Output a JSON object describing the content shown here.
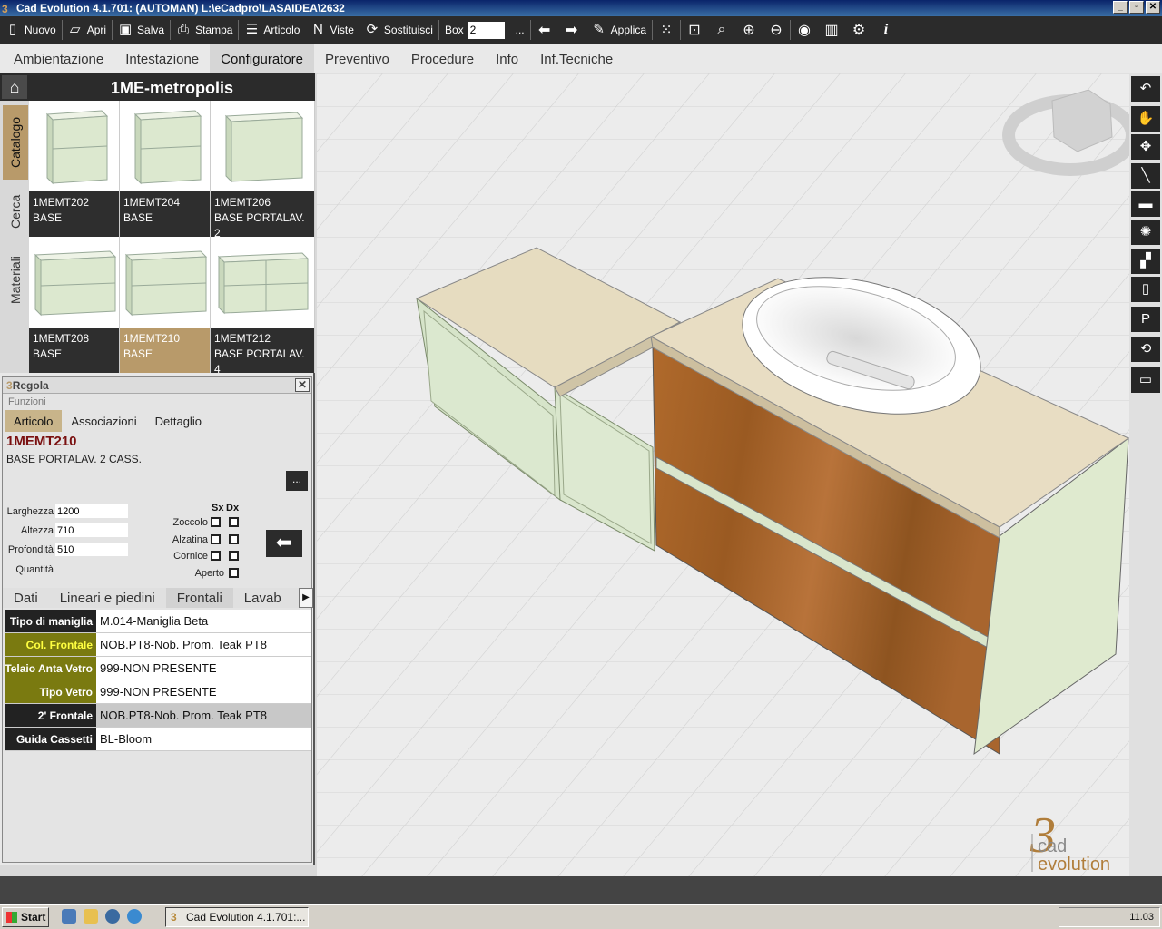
{
  "window": {
    "title": "Cad Evolution 4.1.701: (AUTOMAN)  L:\\eCadpro\\LASAIDEA\\2632",
    "min": "_",
    "max": "▫",
    "close": "✕"
  },
  "toolbar": {
    "new": "Nuovo",
    "open": "Apri",
    "save": "Salva",
    "print": "Stampa",
    "article": "Articolo",
    "views": "Viste",
    "replace": "Sostituisci",
    "box_label": "Box",
    "box_value": "2",
    "ellipsis": "...",
    "apply": "Applica"
  },
  "menu": [
    "Ambientazione",
    "Intestazione",
    "Configuratore",
    "Preventivo",
    "Procedure",
    "Info",
    "Inf.Tecniche"
  ],
  "menu_active": "Configuratore",
  "catalog": {
    "title": "1ME-metropolis",
    "side_tabs": [
      "Catalogo",
      "Cerca",
      "Materiali"
    ],
    "items": [
      {
        "code": "1MEMT202",
        "desc": "BASE"
      },
      {
        "code": "1MEMT204",
        "desc": "BASE"
      },
      {
        "code": "1MEMT206",
        "desc": "BASE PORTALAV. 2"
      },
      {
        "code": "1MEMT208",
        "desc": "BASE"
      },
      {
        "code": "1MEMT210",
        "desc": "BASE"
      },
      {
        "code": "1MEMT212",
        "desc": "BASE PORTALAV. 4"
      }
    ],
    "selected": "1MEMT210"
  },
  "regola": {
    "title": "Regola",
    "close": "✕",
    "funzioni": "Funzioni",
    "tabs": [
      "Articolo",
      "Associazioni",
      "Dettaglio"
    ],
    "active_tab": "Articolo",
    "code": "1MEMT210",
    "desc": "BASE PORTALAV. 2 CASS.",
    "more": "...",
    "dims": {
      "larghezza_label": "Larghezza",
      "larghezza": "1200",
      "altezza_label": "Altezza",
      "altezza": "710",
      "profondita_label": "Profondità",
      "profondita": "510",
      "quantita_label": "Quantità"
    },
    "sx": "Sx",
    "dx": "Dx",
    "checks": [
      "Zoccolo",
      "Alzatina",
      "Cornice",
      "Aperto"
    ],
    "bottom_tabs": [
      "Dati",
      "Lineari e piedini",
      "Frontali",
      "Lavab"
    ],
    "bottom_active": "Frontali",
    "props": [
      {
        "key": "Tipo di maniglia",
        "value": "M.014-Maniglia Beta"
      },
      {
        "key": "Col. Frontale",
        "value": "NOB.PT8-Nob. Prom. Teak PT8"
      },
      {
        "key": "Telaio Anta Vetro",
        "value": "999-NON PRESENTE"
      },
      {
        "key": "Tipo Vetro",
        "value": "999-NON PRESENTE"
      },
      {
        "key": "2' Frontale",
        "value": "NOB.PT8-Nob. Prom. Teak PT8"
      },
      {
        "key": "Guida Cassetti",
        "value": "BL-Bloom"
      }
    ]
  },
  "branding": {
    "line1": "cad",
    "line2": "evolution"
  },
  "colors": {
    "accent": "#b89a6a",
    "teak": "#a5652a",
    "panel_green": "#dfead4"
  },
  "taskbar": {
    "start": "Start",
    "app": "Cad Evolution 4.1.701:...",
    "clock": "11.03"
  }
}
